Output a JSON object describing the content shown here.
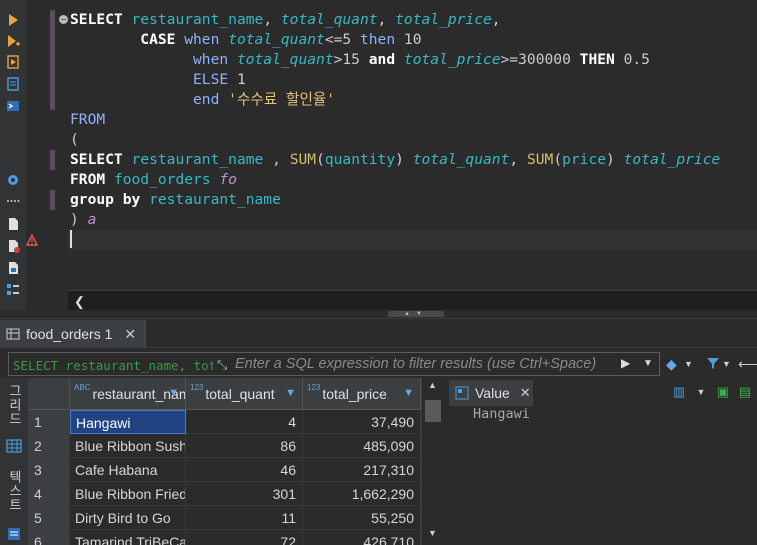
{
  "colors": {
    "bg": "#2b2b2b",
    "keyword": "#ffffff",
    "column": "#37b8c4",
    "function": "#d3bf6b",
    "selection": "#214283"
  },
  "editor": {
    "fold_glyph": "−",
    "lines": [
      [
        [
          "kw",
          "SELECT "
        ],
        [
          "col",
          "restaurant_name"
        ],
        [
          "punc",
          ", "
        ],
        [
          "ital",
          "total_quant"
        ],
        [
          "punc",
          ", "
        ],
        [
          "ital",
          "total_price"
        ],
        [
          "punc",
          ","
        ]
      ],
      [
        [
          "punc",
          "        "
        ],
        [
          "kw",
          "CASE "
        ],
        [
          "kwt",
          "when "
        ],
        [
          "ital",
          "total_quant"
        ],
        [
          "punc",
          "<=5 "
        ],
        [
          "kwt",
          "then "
        ],
        [
          "num",
          "10"
        ]
      ],
      [
        [
          "punc",
          "              "
        ],
        [
          "kwt",
          "when "
        ],
        [
          "ital",
          "total_quant"
        ],
        [
          "punc",
          ">15 "
        ],
        [
          "kw",
          "and "
        ],
        [
          "ital",
          "total_price"
        ],
        [
          "punc",
          ">=300000 "
        ],
        [
          "kw",
          "THEN "
        ],
        [
          "num",
          "0.5"
        ]
      ],
      [
        [
          "punc",
          "              "
        ],
        [
          "kwt",
          "ELSE "
        ],
        [
          "num",
          "1"
        ]
      ],
      [
        [
          "punc",
          "              "
        ],
        [
          "kwt",
          "end "
        ],
        [
          "str",
          "'수수료 할인율'"
        ]
      ],
      [
        [
          "kwt",
          "FROM"
        ]
      ],
      [
        [
          "punc",
          "("
        ]
      ],
      [
        [
          "kw",
          "SELECT "
        ],
        [
          "col",
          "restaurant_name "
        ],
        [
          "punc",
          ", "
        ],
        [
          "fn",
          "SUM"
        ],
        [
          "punc",
          "("
        ],
        [
          "col",
          "quantity"
        ],
        [
          "punc",
          ") "
        ],
        [
          "ital",
          "total_quant"
        ],
        [
          "punc",
          ", "
        ],
        [
          "fn",
          "SUM"
        ],
        [
          "punc",
          "("
        ],
        [
          "col",
          "price"
        ],
        [
          "punc",
          ") "
        ],
        [
          "ital",
          "total_price"
        ]
      ],
      [
        [
          "kw",
          "FROM "
        ],
        [
          "col",
          "food_orders "
        ],
        [
          "alias",
          "fo"
        ]
      ],
      [
        [
          "kw",
          "group by "
        ],
        [
          "col",
          "restaurant_name"
        ]
      ],
      [
        [
          "punc",
          ") "
        ],
        [
          "alias",
          "a"
        ]
      ],
      [
        [
          "caret",
          ""
        ]
      ]
    ]
  },
  "results_tab": {
    "label": "food_orders 1",
    "close": "✕"
  },
  "filter": {
    "sql_text": "SELECT restaurant_name, total_quant, total_price, CASE",
    "placeholder": "Enter a SQL expression to filter results (use Ctrl+Space)"
  },
  "side_tabs": {
    "grid": "그리드",
    "text": "텍스트"
  },
  "grid": {
    "columns": [
      {
        "type": "ABC",
        "label": "restaurant_name"
      },
      {
        "type": "123",
        "label": "total_quant"
      },
      {
        "type": "123",
        "label": "total_price"
      }
    ],
    "rows": [
      {
        "n": "1",
        "name": "Hangawi",
        "quant": "4",
        "price": "37,490"
      },
      {
        "n": "2",
        "name": "Blue Ribbon Sushi",
        "quant": "86",
        "price": "485,090"
      },
      {
        "n": "3",
        "name": "Cafe Habana",
        "quant": "46",
        "price": "217,310"
      },
      {
        "n": "4",
        "name": "Blue Ribbon Fried Chicken",
        "quant": "301",
        "price": "1,662,290"
      },
      {
        "n": "5",
        "name": "Dirty Bird to Go",
        "quant": "11",
        "price": "55,250"
      },
      {
        "n": "6",
        "name": "Tamarind TriBeCa",
        "quant": "72",
        "price": "426,710"
      }
    ]
  },
  "value_panel": {
    "tab_label": "Value",
    "close": "✕",
    "content": "Hangawi"
  }
}
